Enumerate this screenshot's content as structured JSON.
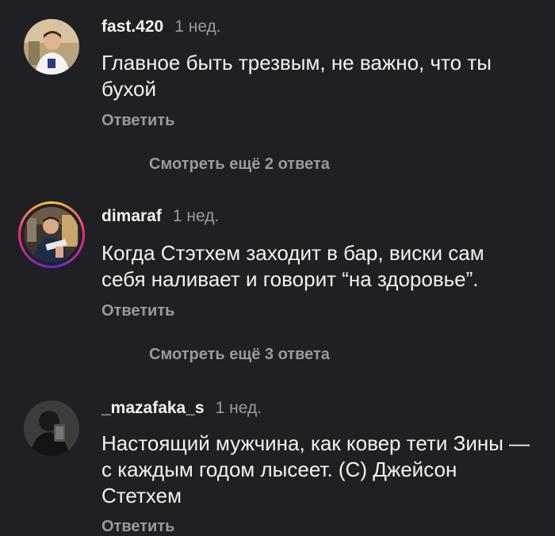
{
  "comments": [
    {
      "username": "fast.420",
      "time": "1 нед.",
      "text": "Главное быть трезвым, не важно, что ты бухой",
      "reply_label": "Ответить",
      "more_replies": "Смотреть ещё 2 ответа"
    },
    {
      "username": "dimaraf",
      "time": "1 нед.",
      "text": "Когда Стэтхем заходит в бар, виски сам себя наливает и говорит “на здоровье”.",
      "reply_label": "Ответить",
      "more_replies": "Смотреть ещё 3 ответа"
    },
    {
      "username": "_mazafaka_s",
      "time": "1 нед.",
      "text": "Настоящий мужчина, как ковер тети Зины — с каждым годом лысеет. (С) Джейсон Стетхем",
      "reply_label": "Ответить"
    }
  ],
  "colors": {
    "background": "#1f2024",
    "text": "#f2f2f2",
    "secondary": "#9a9a9e",
    "story_ring": [
      "#f9ce34",
      "#ee2a7b",
      "#6228d7"
    ]
  }
}
